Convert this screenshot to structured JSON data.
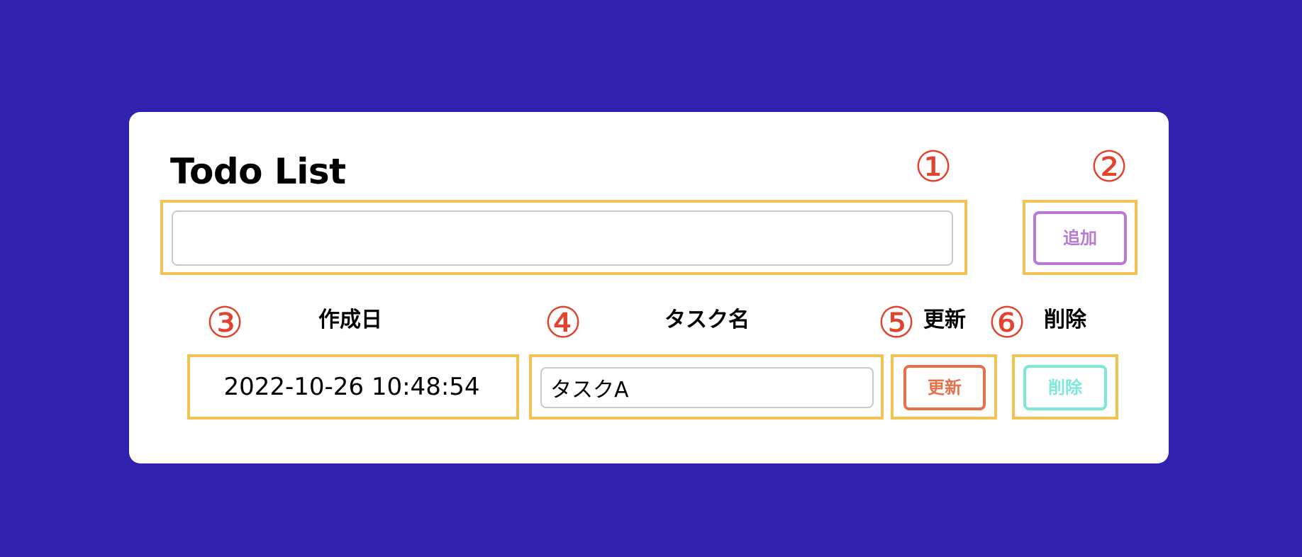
{
  "app": {
    "title": "Todo List"
  },
  "markers": {
    "m1": "①",
    "m2": "②",
    "m3": "③",
    "m4": "④",
    "m5": "⑤",
    "m6": "⑥"
  },
  "form": {
    "new_task_value": "",
    "add_label": "追加"
  },
  "table": {
    "headers": {
      "created": "作成日",
      "task_name": "タスク名",
      "update": "更新",
      "delete": "削除"
    },
    "rows": [
      {
        "created": "2022-10-26 10:48:54",
        "task_name": "タスクA",
        "update_label": "更新",
        "delete_label": "削除"
      }
    ]
  },
  "colors": {
    "background": "#3021ae",
    "highlight": "#f2c353",
    "marker": "#e0442e",
    "add_button": "#b87ad6",
    "update_button": "#e4714a",
    "delete_button": "#7ee8d8"
  }
}
